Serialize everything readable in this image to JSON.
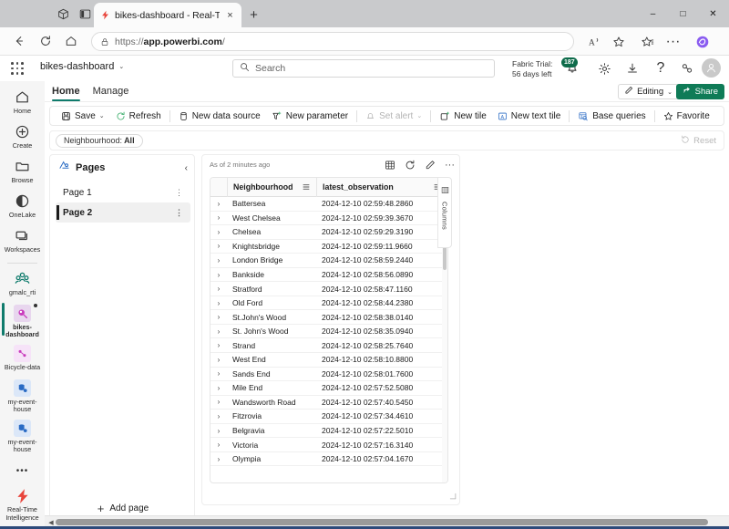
{
  "browser": {
    "tab": {
      "title": "bikes-dashboard - Real-Time Inte",
      "favicon": "fabric-bolt-icon",
      "close": "×"
    },
    "new_tab": "+",
    "window_controls": {
      "minimize": "–",
      "maximize": "□",
      "close": "✕"
    },
    "nav": {
      "back": "←",
      "refresh": "↻",
      "home": "⌂"
    },
    "address": {
      "scheme": "https://",
      "host": "app.powerbi.com",
      "path": "/",
      "lock": "lock-icon"
    },
    "omni_actions": {
      "read_aloud": "A",
      "favorite": "☆",
      "collections": "☆",
      "more": "···",
      "copilot": "copilot-icon"
    }
  },
  "appbar": {
    "brand": "bikes-dashboard",
    "brand_chevron": "⌄",
    "search_placeholder": "Search",
    "trial_line1": "Fabric Trial:",
    "trial_line2": "56 days left",
    "notification_count": "187",
    "settings": "⚙",
    "downloads": "↓",
    "help": "?",
    "feedback": "feedback-icon"
  },
  "rail": {
    "items": [
      {
        "label": "Home",
        "icon": "home-icon",
        "selected": false
      },
      {
        "label": "Create",
        "icon": "plus-circle-icon",
        "selected": false
      },
      {
        "label": "Browse",
        "icon": "folder-icon",
        "selected": false
      },
      {
        "label": "OneLake",
        "icon": "onelake-icon",
        "selected": false
      },
      {
        "label": "Workspaces",
        "icon": "workspaces-icon",
        "selected": false
      }
    ],
    "workspace": {
      "label": "gmalc_rti",
      "icon": "people-group-icon"
    },
    "artifacts": [
      {
        "label": "bikes-dashboard",
        "icon": "realtime-dashboard-icon",
        "selected": true,
        "color": "#e8d6ee"
      },
      {
        "label": "Bicycle-data",
        "icon": "eventstream-icon",
        "selected": false,
        "color": "#f3e0f5"
      },
      {
        "label": "my-event-house",
        "icon": "eventhouse-icon",
        "selected": false,
        "color": "#dbe7f8"
      },
      {
        "label": "my-event-house",
        "icon": "eventhouse-icon",
        "selected": false,
        "color": "#dbe7f8"
      }
    ],
    "more": "•••",
    "footer": {
      "label": "Real-Time Intelligence",
      "icon": "realtime-bolt-icon"
    }
  },
  "canvas": {
    "tabs": [
      {
        "label": "Home",
        "active": true
      },
      {
        "label": "Manage",
        "active": false
      }
    ],
    "editing_label": "Editing",
    "editing_chevron": "⌄",
    "editing_icon": "pencil-icon",
    "share_label": "Share",
    "share_icon": "share-icon",
    "share_color": "#0f7b57"
  },
  "ribbon": {
    "commands": [
      {
        "label": "Save",
        "icon": "save-icon",
        "chevron": "⌄",
        "disabled": false
      },
      {
        "label": "Refresh",
        "icon": "refresh-icon",
        "chevron": "",
        "disabled": false
      },
      {
        "label": "New data source",
        "icon": "database-icon",
        "chevron": "",
        "disabled": false
      },
      {
        "label": "New parameter",
        "icon": "parameter-icon",
        "chevron": "",
        "disabled": false
      },
      {
        "label": "Set alert",
        "icon": "alert-icon",
        "chevron": "⌄",
        "disabled": true
      },
      {
        "label": "New tile",
        "icon": "new-tile-icon",
        "chevron": "",
        "disabled": false
      },
      {
        "label": "New text tile",
        "icon": "text-tile-icon",
        "chevron": "",
        "disabled": false
      },
      {
        "label": "Base queries",
        "icon": "base-queries-icon",
        "chevron": "",
        "disabled": false
      },
      {
        "label": "Favorite",
        "icon": "star-icon",
        "chevron": "",
        "disabled": false
      }
    ]
  },
  "filterbar": {
    "pill_label": "Neighbourhood:",
    "pill_value": "All",
    "reset_label": "Reset",
    "reset_icon": "reset-icon"
  },
  "pages": {
    "title": "Pages",
    "title_icon": "pages-icon",
    "collapse_icon": "‹",
    "items": [
      {
        "label": "Page 1",
        "selected": false
      },
      {
        "label": "Page 2",
        "selected": true
      }
    ],
    "kebab": "⋮",
    "add_page_label": "Add page",
    "add_page_icon": "+"
  },
  "tile": {
    "timestamp": "As of 2 minutes ago",
    "tools": {
      "table_view": "table-view-icon",
      "refresh": "refresh-icon",
      "edit": "pencil-icon",
      "more": "···"
    },
    "columns_panel_label": "Columns",
    "columns_panel_icon": "columns-icon",
    "resize_handle": "resize-handle-icon",
    "grid": {
      "expand_header": "",
      "columns": [
        "Neighbourhood",
        "latest_observation"
      ],
      "column_menu_icon": "column-menu-icon",
      "row_expand_icon": "›",
      "rows": [
        {
          "neighbourhood": "Battersea",
          "latest_observation": "2024-12-10 02:59:48.2860"
        },
        {
          "neighbourhood": "West Chelsea",
          "latest_observation": "2024-12-10 02:59:39.3670"
        },
        {
          "neighbourhood": "Chelsea",
          "latest_observation": "2024-12-10 02:59:29.3190"
        },
        {
          "neighbourhood": "Knightsbridge",
          "latest_observation": "2024-12-10 02:59:11.9660"
        },
        {
          "neighbourhood": "London Bridge",
          "latest_observation": "2024-12-10 02:58:59.2440"
        },
        {
          "neighbourhood": "Bankside",
          "latest_observation": "2024-12-10 02:58:56.0890"
        },
        {
          "neighbourhood": "Stratford",
          "latest_observation": "2024-12-10 02:58:47.1160"
        },
        {
          "neighbourhood": "Old Ford",
          "latest_observation": "2024-12-10 02:58:44.2380"
        },
        {
          "neighbourhood": "St.John's Wood",
          "latest_observation": "2024-12-10 02:58:38.0140"
        },
        {
          "neighbourhood": "St. John's Wood",
          "latest_observation": "2024-12-10 02:58:35.0940"
        },
        {
          "neighbourhood": "Strand",
          "latest_observation": "2024-12-10 02:58:25.7640"
        },
        {
          "neighbourhood": "West End",
          "latest_observation": "2024-12-10 02:58:10.8800"
        },
        {
          "neighbourhood": "Sands End",
          "latest_observation": "2024-12-10 02:58:01.7600"
        },
        {
          "neighbourhood": "Mile End",
          "latest_observation": "2024-12-10 02:57:52.5080"
        },
        {
          "neighbourhood": "Wandsworth Road",
          "latest_observation": "2024-12-10 02:57:40.5450"
        },
        {
          "neighbourhood": "Fitzrovia",
          "latest_observation": "2024-12-10 02:57:34.4610"
        },
        {
          "neighbourhood": "Belgravia",
          "latest_observation": "2024-12-10 02:57:22.5010"
        },
        {
          "neighbourhood": "Victoria",
          "latest_observation": "2024-12-10 02:57:16.3140"
        },
        {
          "neighbourhood": "Olympia",
          "latest_observation": "2024-12-10 02:57:04.1670"
        }
      ]
    }
  },
  "scrollbar": {
    "left_arrow": "◀",
    "right_arrow": "▶"
  }
}
